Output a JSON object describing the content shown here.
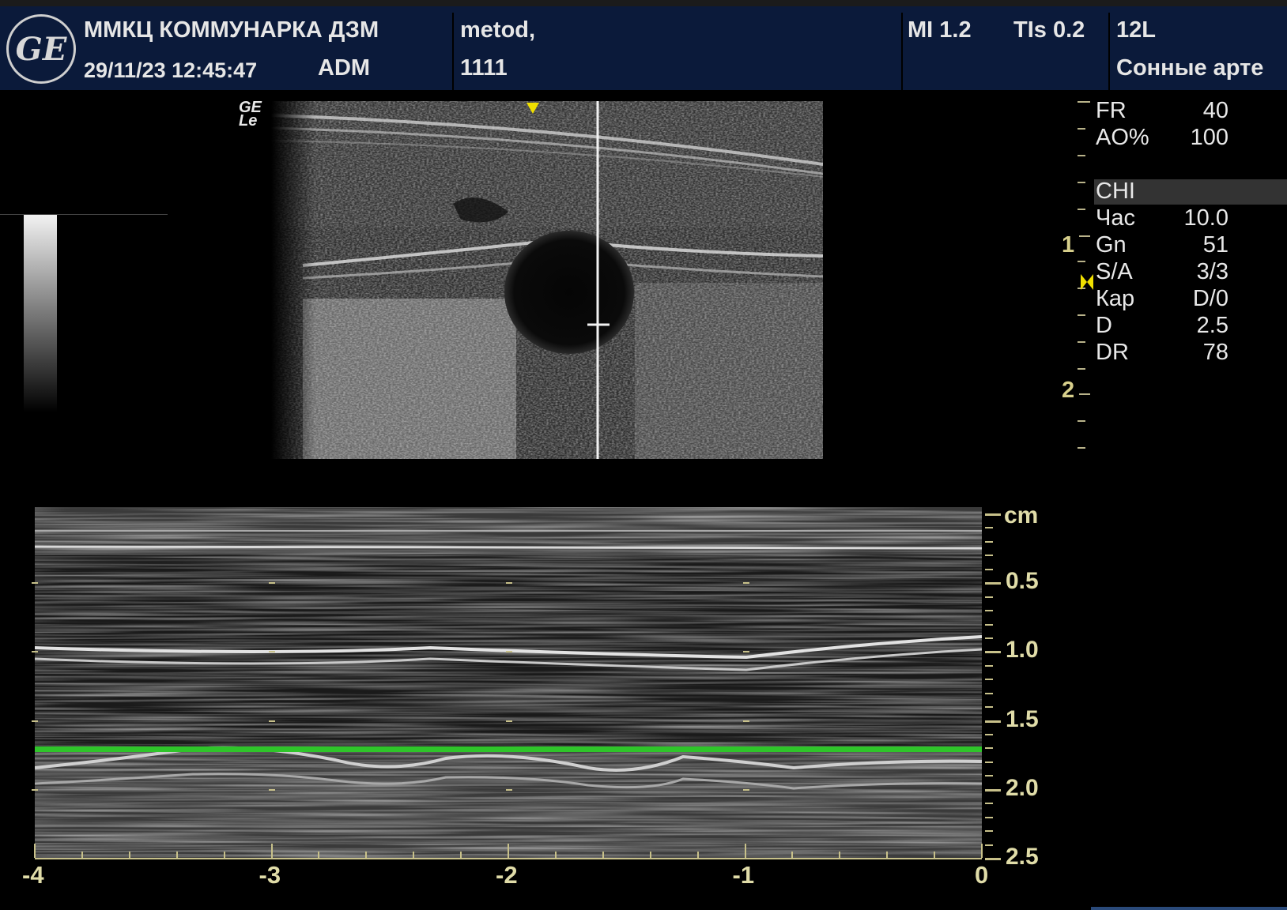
{
  "header": {
    "logo_text": "GE",
    "institution": "ММКЦ КОММУНАРКА ДЗМ",
    "datetime": "29/11/23 12:45:47",
    "operator": "ADM",
    "patient_name": "metod,",
    "patient_id": "1111",
    "mi": "MI 1.2",
    "tis": "TIs 0.2",
    "probe": "12L",
    "preset": "Сонные арте"
  },
  "image_label": {
    "line1": "GE",
    "line2": "Le"
  },
  "params": [
    {
      "name": "FR",
      "value": "40"
    },
    {
      "name": "AO%",
      "value": "100"
    },
    {
      "name": "CHI",
      "value": ""
    },
    {
      "name": "Час",
      "value": "10.0"
    },
    {
      "name": "Gn",
      "value": "51"
    },
    {
      "name": "S/A",
      "value": "3/3"
    },
    {
      "name": "Кар",
      "value": "D/0"
    },
    {
      "name": "D",
      "value": "2.5"
    },
    {
      "name": "DR",
      "value": "78"
    }
  ],
  "depth_labels": [
    "1",
    "2"
  ],
  "mmode": {
    "depth_unit": "cm",
    "depth_labels": [
      "0.5",
      "1.0",
      "1.5",
      "2.0",
      "2.5"
    ],
    "time_labels": [
      "-4",
      "-3",
      "-2",
      "-1",
      "0"
    ]
  },
  "colors": {
    "header_bg": "#0b1a3a",
    "sweep_line": "#2fc52a",
    "scale_text": "#e0dca8",
    "marker": "#f0e000"
  }
}
